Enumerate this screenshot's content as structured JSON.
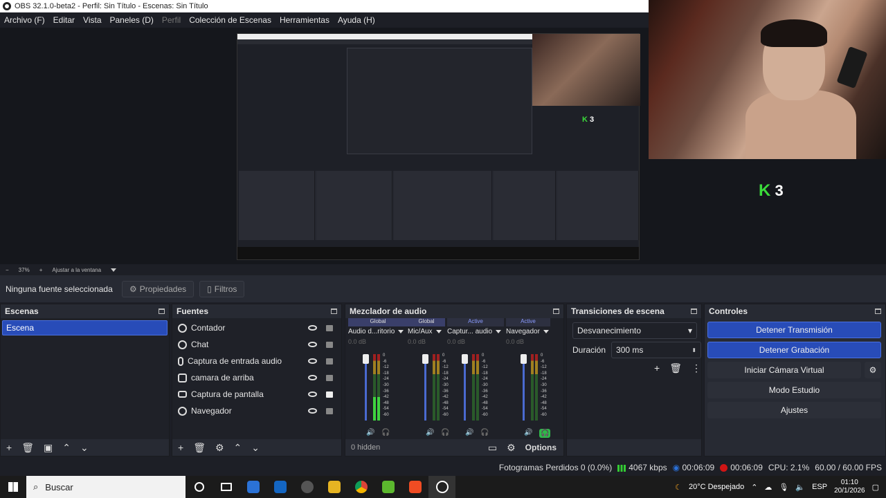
{
  "window": {
    "title": "OBS 32.1.0-beta2 - Perfil: Sin Título - Escenas: Sin Título"
  },
  "menu": [
    {
      "label": "Archivo (F)",
      "enabled": true
    },
    {
      "label": "Editar",
      "enabled": true
    },
    {
      "label": "Vista",
      "enabled": true
    },
    {
      "label": "Paneles (D)",
      "enabled": true
    },
    {
      "label": "Perfil",
      "enabled": false
    },
    {
      "label": "Colección de Escenas",
      "enabled": true
    },
    {
      "label": "Herramientas",
      "enabled": true
    },
    {
      "label": "Ayuda (H)",
      "enabled": true
    }
  ],
  "overlay": {
    "k3": "3",
    "k3_mark": "K"
  },
  "zoom": {
    "minus": "−",
    "value": "37%",
    "plus": "+",
    "fit_label": "Ajustar a la ventana"
  },
  "source_bar": {
    "no_selection": "Ninguna fuente seleccionada",
    "properties": "Propiedades",
    "filters": "Filtros"
  },
  "scenes": {
    "title": "Escenas",
    "items": [
      "Escena"
    ]
  },
  "sources": {
    "title": "Fuentes",
    "items": [
      {
        "label": "Contador",
        "icon": "globe-icon",
        "locked": false
      },
      {
        "label": "Chat",
        "icon": "globe-icon",
        "locked": false
      },
      {
        "label": "Captura de entrada audio",
        "icon": "microphone-icon",
        "locked": false
      },
      {
        "label": "camara de arriba",
        "icon": "camera-icon",
        "locked": false
      },
      {
        "label": "Captura de pantalla",
        "icon": "monitor-icon",
        "locked": true
      },
      {
        "label": "Navegador",
        "icon": "globe-icon",
        "locked": false
      }
    ]
  },
  "mixer": {
    "title": "Mezclador de audio",
    "hidden_label": "0 hidden",
    "options_label": "Options",
    "ticks": [
      "0",
      "-6",
      "-12",
      "-18",
      "-24",
      "-30",
      "-36",
      "-42",
      "-48",
      "-54",
      "-60"
    ],
    "channels": [
      {
        "tag": "Global",
        "active": false,
        "name": "Audio d...ritorio",
        "db": "0.0 dB",
        "level": 0.35
      },
      {
        "tag": "Global",
        "active": false,
        "name": "Mic/Aux",
        "db": "0.0 dB",
        "level": 0.0
      },
      {
        "tag": "Active",
        "active": true,
        "name": "Captur... audio",
        "db": "0.0 dB",
        "level": 0.0
      },
      {
        "tag": "Active",
        "active": true,
        "name": "Navegador",
        "db": "0.0 dB",
        "level": 0.0
      }
    ]
  },
  "transitions": {
    "title": "Transiciones de escena",
    "type": "Desvanecimiento",
    "duration_label": "Duración",
    "duration_value": "300 ms"
  },
  "controls": {
    "title": "Controles",
    "stop_stream": "Detener Transmisión",
    "stop_record": "Detener Grabación",
    "virtual_cam": "Iniciar Cámara Virtual",
    "studio_mode": "Modo Estudio",
    "settings": "Ajustes"
  },
  "status": {
    "dropped_frames": "Fotogramas Perdidos 0 (0.0%)",
    "bitrate": "4067 kbps",
    "stream_time": "00:06:09",
    "record_time": "00:06:09",
    "cpu": "CPU: 2.1%",
    "fps": "60.00 / 60.00 FPS"
  },
  "taskbar": {
    "search_placeholder": "Buscar",
    "weather": "20°C  Despejado",
    "lang": "ESP",
    "time": "01:10",
    "date": "20/1/2026"
  },
  "colors": {
    "accent": "#284cb8",
    "record": "#d01515",
    "meter_green": "#3fd43f",
    "k3_green": "#3bdc3b"
  }
}
